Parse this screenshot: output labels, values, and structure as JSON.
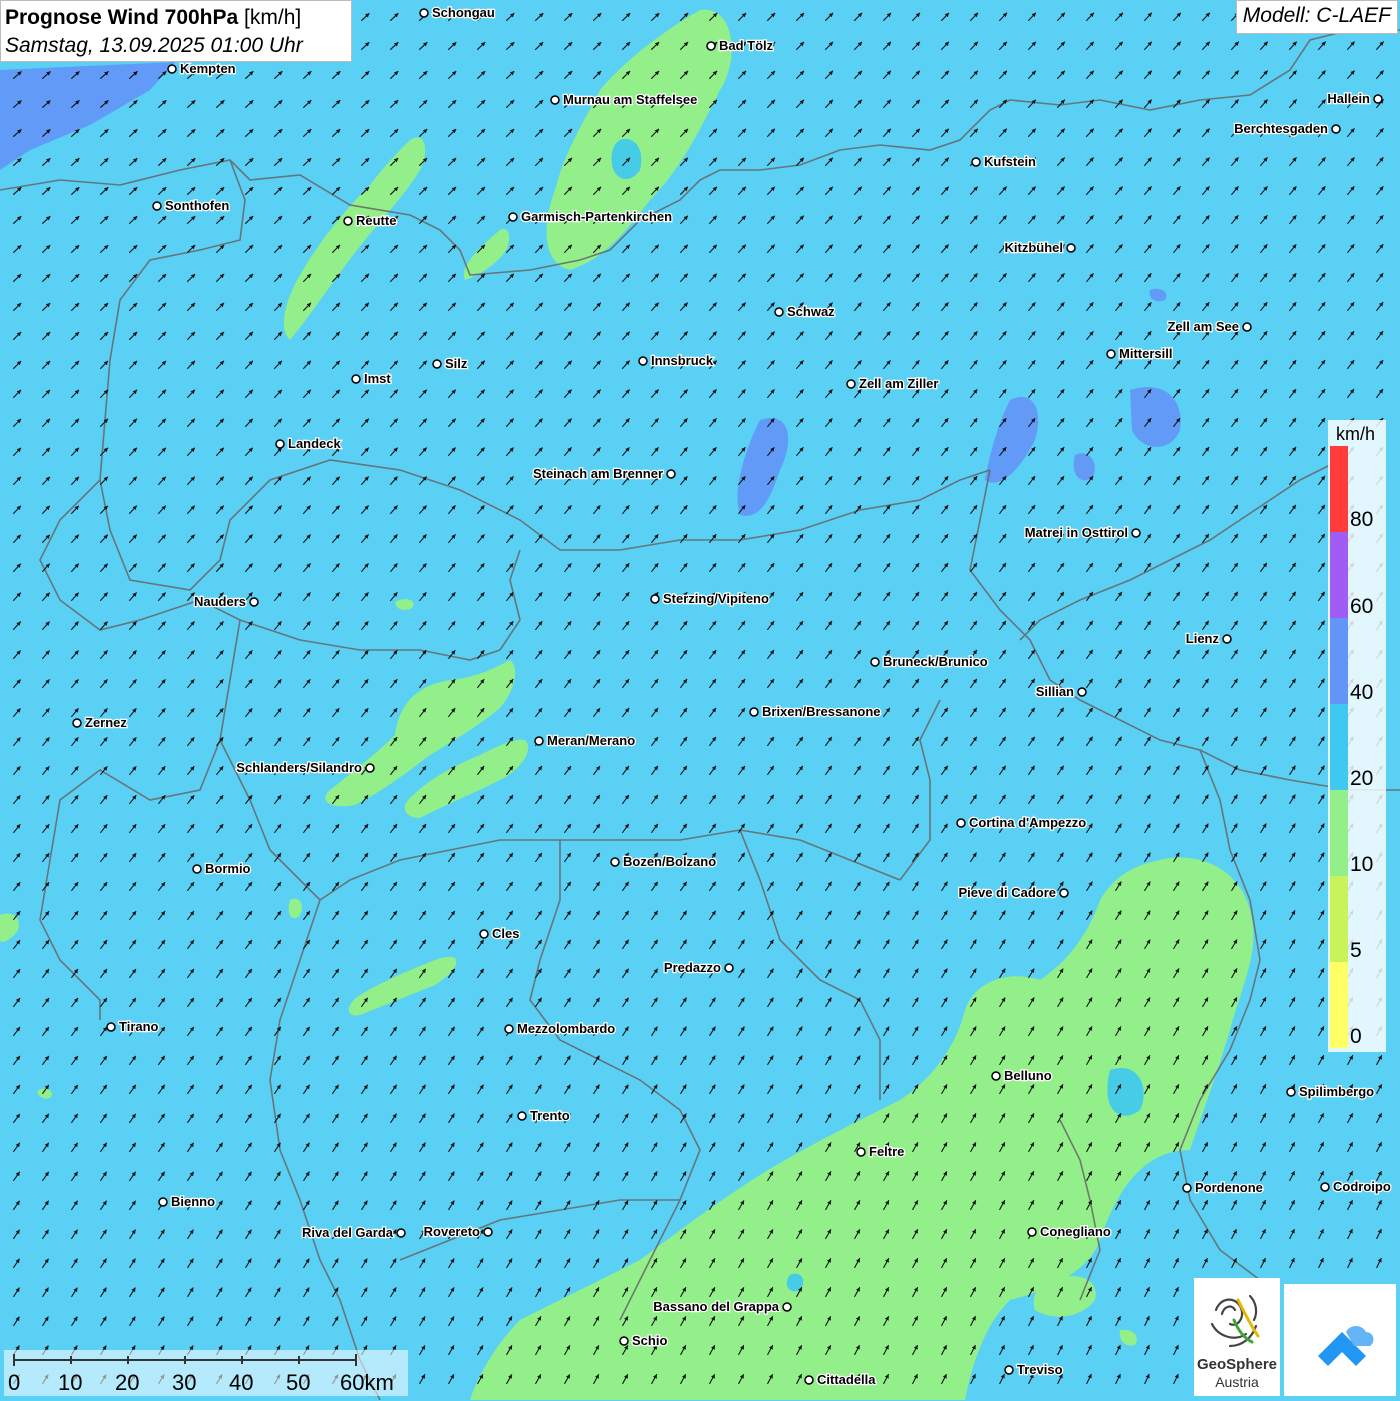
{
  "header": {
    "title_bold": "Prognose Wind 700hPa",
    "title_unit": "[km/h]",
    "datetime": "Samstag, 13.09.2025 01:00 Uhr",
    "model": "Modell: C-LAEF"
  },
  "legend": {
    "unit": "km/h",
    "labels": [
      "80",
      "60",
      "40",
      "20",
      "10",
      "5",
      "0"
    ],
    "colors": [
      "#ff3b3b",
      "#a05cf5",
      "#6395f7",
      "#3fc8f2",
      "#93ef8a",
      "#c8f35a",
      "#ffff66"
    ]
  },
  "scale_bar": {
    "labels": [
      "0",
      "10",
      "20",
      "30",
      "40",
      "50",
      "60km"
    ]
  },
  "branding": {
    "geosphere_name": "GeoSphere",
    "geosphere_country": "Austria"
  },
  "wind": {
    "direction": "south-westerly",
    "dominant_speed_class": "20"
  },
  "colors": {
    "background_20_40": "#5ad0f5",
    "band_10_20": "#93ef8a",
    "band_40_60": "#6395f7",
    "border_line": "#666666"
  },
  "cities": [
    {
      "name": "Schongau"
    },
    {
      "name": "Bad Tölz"
    },
    {
      "name": "Kempten"
    },
    {
      "name": "Murnau am Staffelsee"
    },
    {
      "name": "Hallein"
    },
    {
      "name": "Berchtesgaden"
    },
    {
      "name": "Kufstein"
    },
    {
      "name": "Sonthofen"
    },
    {
      "name": "Reutte"
    },
    {
      "name": "Garmisch-Partenkirchen"
    },
    {
      "name": "Kitzbühel"
    },
    {
      "name": "Schwaz"
    },
    {
      "name": "Zell am See"
    },
    {
      "name": "Mittersill"
    },
    {
      "name": "Innsbruck"
    },
    {
      "name": "Silz"
    },
    {
      "name": "Imst"
    },
    {
      "name": "Zell am Ziller"
    },
    {
      "name": "Landeck"
    },
    {
      "name": "Steinach am Brenner"
    },
    {
      "name": "Matrei in Osttirol"
    },
    {
      "name": "Nauders"
    },
    {
      "name": "Sterzing/Vipiteno"
    },
    {
      "name": "Lienz"
    },
    {
      "name": "Bruneck/Brunico"
    },
    {
      "name": "Sillian"
    },
    {
      "name": "Zernez"
    },
    {
      "name": "Brixen/Bressanone"
    },
    {
      "name": "Meran/Merano"
    },
    {
      "name": "Schlanders/Silandro"
    },
    {
      "name": "Cortina d'Ampezzo"
    },
    {
      "name": "Bozen/Bolzano"
    },
    {
      "name": "Bormio"
    },
    {
      "name": "Pieve di Cadore"
    },
    {
      "name": "Cles"
    },
    {
      "name": "Predazzo"
    },
    {
      "name": "Tirano"
    },
    {
      "name": "Mezzolombardo"
    },
    {
      "name": "Belluno"
    },
    {
      "name": "Spilimbergo"
    },
    {
      "name": "Trento"
    },
    {
      "name": "Feltre"
    },
    {
      "name": "Pordenone"
    },
    {
      "name": "Codroipo"
    },
    {
      "name": "Bienno"
    },
    {
      "name": "Riva del Garda"
    },
    {
      "name": "Rovereto"
    },
    {
      "name": "Conegliano"
    },
    {
      "name": "Bassano del Grappa"
    },
    {
      "name": "Schio"
    },
    {
      "name": "Treviso"
    },
    {
      "name": "Cittadella"
    }
  ]
}
